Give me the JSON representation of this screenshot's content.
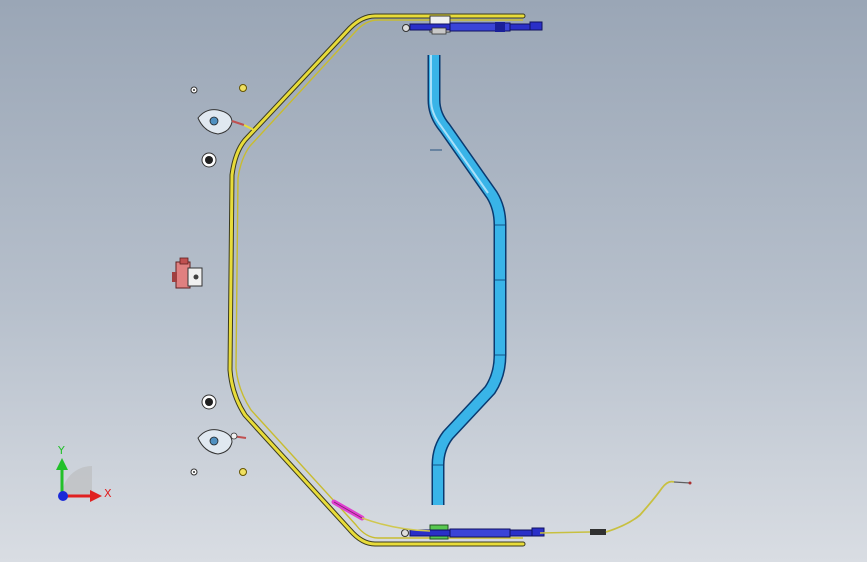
{
  "viewport": {
    "background_top": "#9aa6b6",
    "background_bottom": "#d9dde3"
  },
  "triad": {
    "y_label": "Y",
    "x_label": "X",
    "y_color": "#22c02a",
    "x_color": "#e02020",
    "z_color": "#1a2ad8"
  },
  "model": {
    "brake_line_color": "#e8dc3a",
    "fuel_pipe_color": "#39b4e8",
    "actuator_color": "#2a2fc8",
    "sleeve_color": "#e040d0",
    "bracket_color": "#58c850",
    "regulator_color": "#e08080"
  }
}
